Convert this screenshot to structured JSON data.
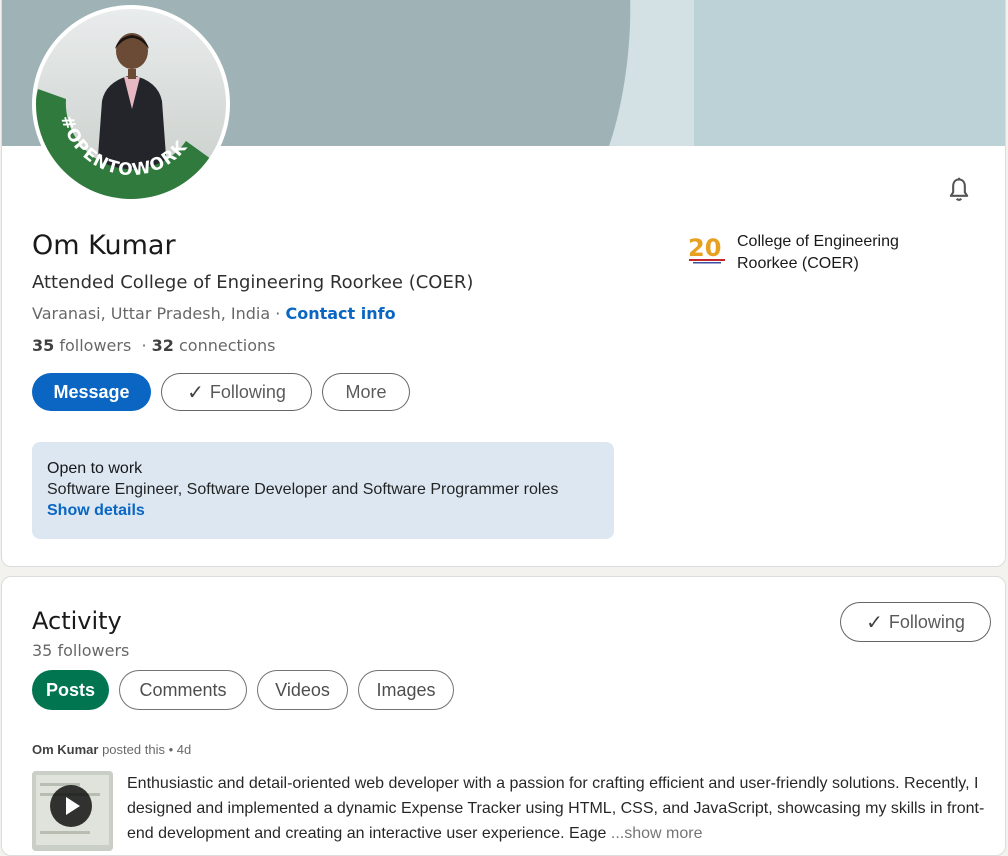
{
  "profile": {
    "name": "Om Kumar",
    "headline": "Attended College of Engineering Roorkee (COER)",
    "location": "Varanasi, Uttar Pradesh, India",
    "location_separator": " · ",
    "contact_info": "Contact info",
    "followers_count": "35",
    "followers_label": " followers",
    "connections_sep": "  · ",
    "connections_count": "32",
    "connections_label": " connections",
    "frame_text": "#OPENTOWORK",
    "buttons": {
      "message": "Message",
      "following_check": "✓",
      "following": "Following",
      "more": "More"
    },
    "open_to_work": {
      "title": "Open to work",
      "roles": "Software Engineer, Software Developer and Software Programmer roles",
      "link": "Show details"
    },
    "education": {
      "school": "College of Engineering Roorkee (COER)",
      "logo_text": "20"
    },
    "colors": {
      "primary": "#0a66c2",
      "open_to_work_green": "#2f7a3c",
      "chip_active": "#01754f"
    }
  },
  "activity": {
    "title": "Activity",
    "followers": "35 followers",
    "follow_button_check": "✓",
    "follow_button": "Following",
    "tabs": [
      "Posts",
      "Comments",
      "Videos",
      "Images"
    ],
    "post": {
      "author": "Om Kumar",
      "meta": " posted this • 4d",
      "text": "Enthusiastic and detail-oriented web developer with a passion for crafting efficient and user-friendly solutions. Recently, I designed and implemented a dynamic Expense Tracker using HTML, CSS, and JavaScript, showcasing my skills in front-end development and creating an interactive user experience. Eage",
      "show_more": "...show more"
    }
  }
}
